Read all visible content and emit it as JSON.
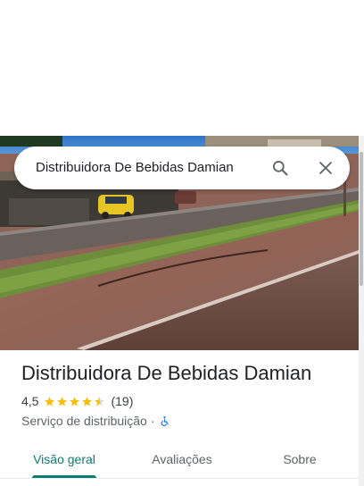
{
  "search": {
    "query": "Distribuidora De Bebidas Damian",
    "search_icon": "search-icon",
    "close_icon": "close-icon"
  },
  "place": {
    "name": "Distribuidora De Bebidas Damian",
    "rating": "4,5",
    "stars": 4.5,
    "reviews": "(19)",
    "category": "Serviço de distribuição",
    "separator": "·",
    "accessibility_icon": "wheelchair-icon"
  },
  "tabs": [
    {
      "label": "Visão geral",
      "active": true
    },
    {
      "label": "Avaliações",
      "active": false
    },
    {
      "label": "Sobre",
      "active": false
    }
  ],
  "colors": {
    "accent": "#0b7c6f",
    "star": "#fbbc04",
    "accessibility": "#1a73e8"
  }
}
